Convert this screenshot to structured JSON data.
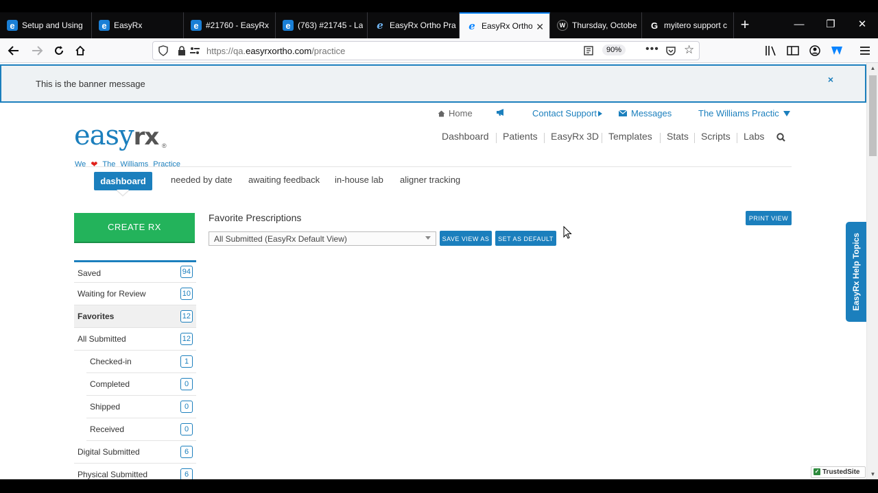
{
  "browser": {
    "tabs": [
      {
        "title": "Setup and Using",
        "icon": "edge-e"
      },
      {
        "title": "EasyRx",
        "icon": "edge-e"
      },
      {
        "title": "#21760 - EasyRx",
        "icon": "edge-e"
      },
      {
        "title": "(763) #21745 - La",
        "icon": "edge-e"
      },
      {
        "title": "EasyRx Ortho Pra",
        "icon": "edge-e"
      },
      {
        "title": "EasyRx Ortho",
        "icon": "edge-e"
      },
      {
        "title": "Thursday, Octobe",
        "icon": "wordpress"
      },
      {
        "title": "myitero support c",
        "icon": "google"
      }
    ],
    "active_tab_index": 5,
    "url_prefix": "https://qa.",
    "url_domain": "easyrxortho.com",
    "url_path": "/practice",
    "zoom": "90%"
  },
  "banner": {
    "message": "This is the banner message",
    "close_glyph": "×"
  },
  "topnav": {
    "home": "Home",
    "contact_support": "Contact Support",
    "messages": "Messages",
    "practice": "The Williams Practic"
  },
  "logo": {
    "easy": "easy",
    "rx": "rx",
    "reg": "®"
  },
  "tagline": {
    "we": "We",
    "the": "The",
    "williams": "Williams",
    "practice": "Practice"
  },
  "mainnav": [
    "Dashboard",
    "Patients",
    "EasyRx 3D",
    "Templates",
    "Stats",
    "Scripts",
    "Labs"
  ],
  "subtabs": [
    "dashboard",
    "needed by date",
    "awaiting feedback",
    "in-house lab",
    "aligner tracking"
  ],
  "create_button": "CREATE RX",
  "sidebar": [
    {
      "label": "Saved",
      "count": "94"
    },
    {
      "label": "Waiting for Review",
      "count": "10"
    },
    {
      "label": "Favorites",
      "count": "12"
    },
    {
      "label": "All Submitted",
      "count": "12"
    },
    {
      "label": "Checked-in",
      "count": "1"
    },
    {
      "label": "Completed",
      "count": "0"
    },
    {
      "label": "Shipped",
      "count": "0"
    },
    {
      "label": "Received",
      "count": "0"
    },
    {
      "label": "Digital Submitted",
      "count": "6"
    },
    {
      "label": "Physical Submitted",
      "count": "6"
    }
  ],
  "main": {
    "title": "Favorite Prescriptions",
    "view_select": "All Submitted (EasyRx Default View)",
    "save_view_as": "SAVE VIEW AS",
    "set_as_default": "SET AS DEFAULT",
    "print_view": "PRINT VIEW"
  },
  "help_tab": "EasyRx Help Topics",
  "trusted_site": "TrustedSite",
  "colors": {
    "accent": "#1b7fbd",
    "create": "#23b35b",
    "heart": "#e0211b"
  }
}
